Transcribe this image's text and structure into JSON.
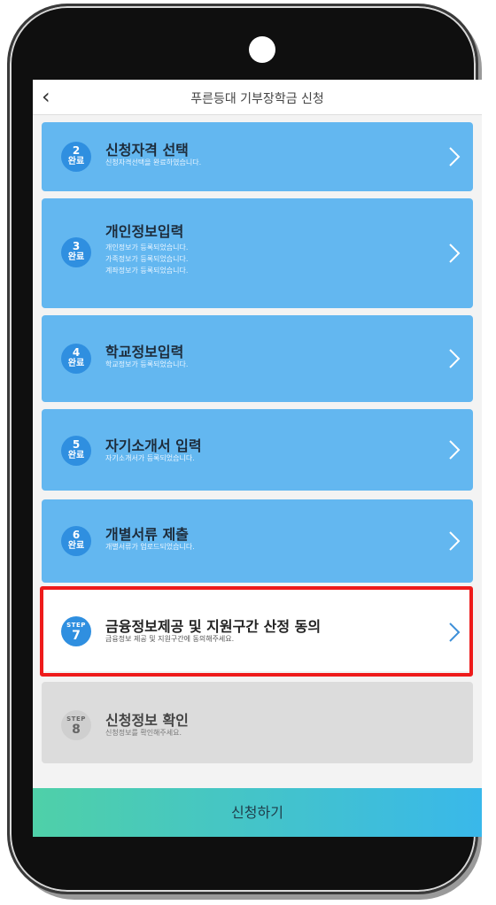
{
  "header": {
    "back_icon": "chevron-left-icon",
    "title": "푸른등대 기부장학금 신청"
  },
  "steps": [
    {
      "num": "2",
      "status": "완료",
      "title": "신청자격 선택",
      "sub": [
        "신청자격선택을 완료하였습니다."
      ]
    },
    {
      "num": "3",
      "status": "완료",
      "title": "개인정보입력",
      "sub": [
        "개인정보가 등록되었습니다.",
        "가족정보가 등록되었습니다.",
        "계좌정보가 등록되었습니다."
      ]
    },
    {
      "num": "4",
      "status": "완료",
      "title": "학교정보입력",
      "sub": [
        "학교정보가 등록되었습니다."
      ]
    },
    {
      "num": "5",
      "status": "완료",
      "title": "자기소개서 입력",
      "sub": [
        "자기소개서가 등록되었습니다."
      ]
    },
    {
      "num": "6",
      "status": "완료",
      "title": "개별서류 제출",
      "sub": [
        "개별서류가 업로드되었습니다."
      ]
    },
    {
      "num": "7",
      "status": "STEP",
      "title": "금융정보제공 및 지원구간 산정 동의",
      "sub": [
        "금융정보 제공 및 지원구간에 동의해주세요."
      ]
    },
    {
      "num": "8",
      "status": "STEP",
      "title": "신청정보 확인",
      "sub": [
        "신청정보를 확인해주세요."
      ]
    }
  ],
  "apply_button": {
    "label": "신청하기"
  },
  "colors": {
    "done_card": "#63b7f0",
    "badge": "#2f8fe0",
    "highlight": "#ee1b1b",
    "apply_gradient_start": "#4fd0a8",
    "apply_gradient_end": "#39b8ea"
  }
}
